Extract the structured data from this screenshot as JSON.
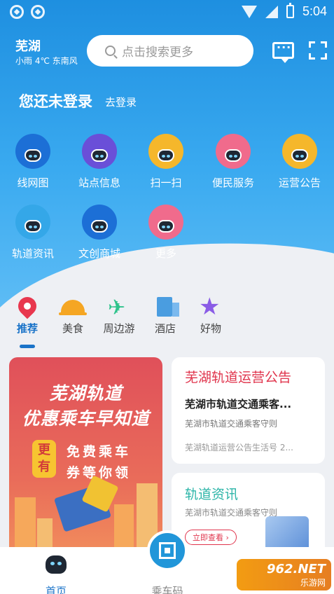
{
  "status_bar": {
    "time": "5:04"
  },
  "header": {
    "city": "芜湖",
    "weather": "小雨 4℃ 东南风",
    "search_placeholder": "点击搜索更多"
  },
  "login": {
    "title": "您还未登录",
    "link": "去登录"
  },
  "grid": [
    {
      "label": "线网图",
      "color": "#1c6fd6"
    },
    {
      "label": "站点信息",
      "color": "#6a4fd8"
    },
    {
      "label": "扫一扫",
      "color": "#f5b72b"
    },
    {
      "label": "便民服务",
      "color": "#f06b8c"
    },
    {
      "label": "运营公告",
      "color": "#f5b72b"
    },
    {
      "label": "轨道资讯",
      "color": "#34a7e8"
    },
    {
      "label": "文创商城",
      "color": "#1c6fd6"
    },
    {
      "label": "更多",
      "color": "#f06b8c"
    }
  ],
  "categories": [
    {
      "label": "推荐",
      "icon": "map-pin-icon",
      "active": true
    },
    {
      "label": "美食",
      "icon": "cloche-icon"
    },
    {
      "label": "周边游",
      "icon": "plane-icon"
    },
    {
      "label": "酒店",
      "icon": "hotel-icon"
    },
    {
      "label": "好物",
      "icon": "star-icon"
    }
  ],
  "promo": {
    "line1": "芜湖轨道",
    "line2": "优惠乘车早知道",
    "badge": "更有",
    "sub1": "免费乘车",
    "sub2": "券等你领"
  },
  "notice_card": {
    "title": "芜湖轨道运营公告",
    "item1": "芜湖市轨道交通乘客...",
    "item2": "芜湖市轨道交通乘客守则",
    "item3": "芜湖轨道运营公告生活号 2..."
  },
  "news_card": {
    "title": "轨道资讯",
    "subtitle": "芜湖市轨道交通乘客守则",
    "button": "立即查看"
  },
  "tabbar": {
    "home": "首页",
    "ride": "乘车码"
  },
  "watermark": {
    "big": "962.NET",
    "small": "乐游网"
  }
}
